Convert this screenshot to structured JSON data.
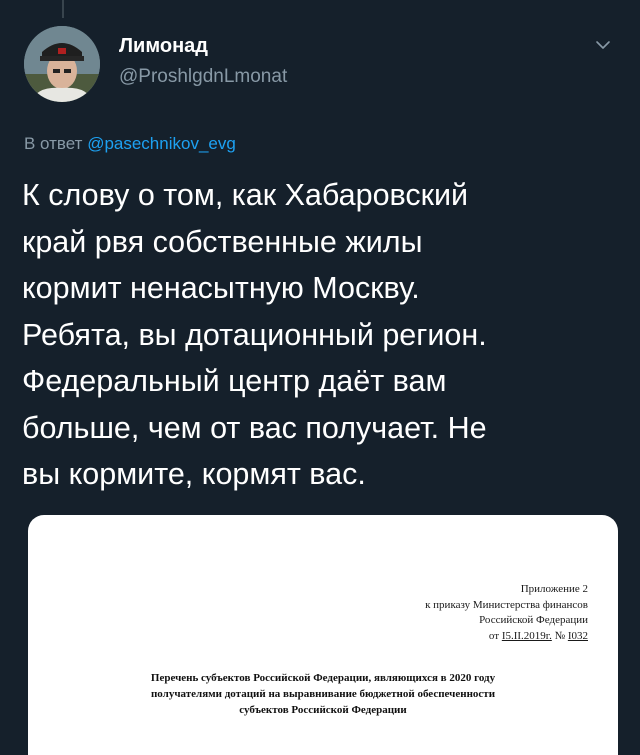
{
  "user": {
    "display_name": "Лимонад",
    "handle": "@ProshlgdnLmonat"
  },
  "reply": {
    "prefix": "В ответ",
    "to": "@pasechnikov_evg"
  },
  "tweet": {
    "lines": [
      "К слову о том, как Хабаровский",
      "край рвя собственные жилы",
      "кормит ненасытную Москву.",
      "Ребята, вы дотационный регион.",
      "Федеральный центр даёт вам",
      "больше, чем от вас получает. Не",
      "вы кормите, кормят вас."
    ]
  },
  "document": {
    "appendix": "Приложение 2",
    "order_line": "к приказу Министерства финансов",
    "country": "Российской Федерации",
    "from_prefix": "от",
    "date": "I5.II.2019г.",
    "number_prefix": "№",
    "number": "I032",
    "title_lines": [
      "Перечень субъектов Российской Федерации, являющихся в 2020 году",
      "получателями дотаций на выравнивание бюджетной обеспеченности",
      "субъектов Российской Федерации"
    ]
  },
  "icons": {
    "menu": "chevron-down-icon"
  },
  "colors": {
    "background": "#15202b",
    "link": "#1da1f2",
    "secondary_text": "#8899a6"
  }
}
